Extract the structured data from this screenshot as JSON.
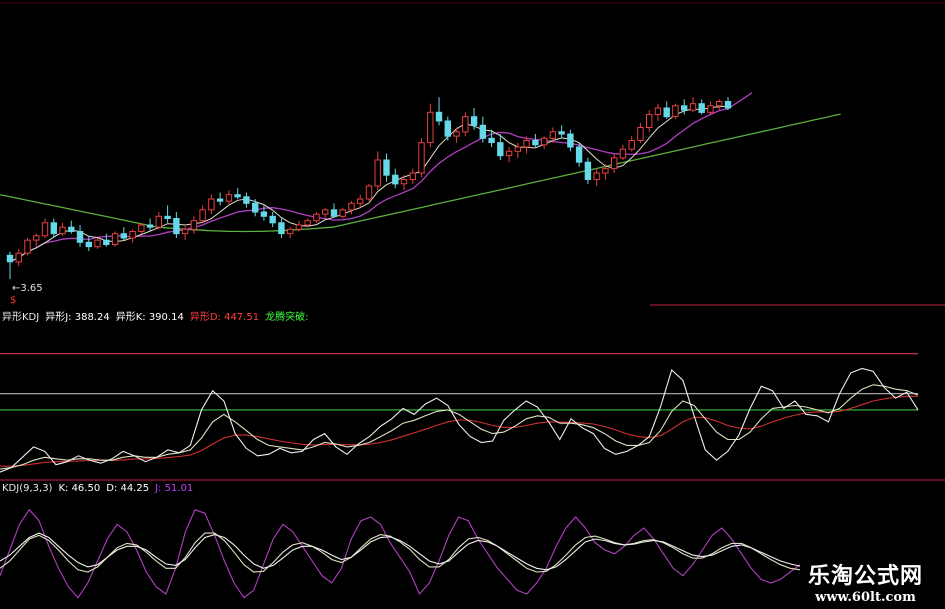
{
  "chart_data": [
    {
      "type": "candlestick",
      "panel": "price",
      "low_label": "3.65",
      "low_marker": "$",
      "colors": {
        "up": "#e8e8e8",
        "down": "#66d9e8",
        "ma_white": "#e0e0d0",
        "ma_magenta": "#b040c0",
        "ma_green": "#5ab040",
        "low_marker": "#ff3030"
      },
      "candles": [
        [
          4.2,
          4.28,
          3.65,
          4.05
        ],
        [
          4.05,
          4.35,
          3.95,
          4.25
        ],
        [
          4.25,
          4.6,
          4.2,
          4.55
        ],
        [
          4.55,
          4.7,
          4.4,
          4.65
        ],
        [
          4.65,
          5.05,
          4.6,
          4.95
        ],
        [
          4.95,
          5.05,
          4.6,
          4.7
        ],
        [
          4.7,
          4.95,
          4.65,
          4.85
        ],
        [
          4.85,
          5.0,
          4.7,
          4.75
        ],
        [
          4.75,
          4.9,
          4.4,
          4.5
        ],
        [
          4.5,
          4.65,
          4.3,
          4.4
        ],
        [
          4.4,
          4.6,
          4.35,
          4.55
        ],
        [
          4.55,
          4.7,
          4.4,
          4.45
        ],
        [
          4.45,
          4.75,
          4.4,
          4.7
        ],
        [
          4.7,
          4.85,
          4.55,
          4.6
        ],
        [
          4.6,
          4.8,
          4.5,
          4.75
        ],
        [
          4.75,
          4.95,
          4.7,
          4.9
        ],
        [
          4.9,
          5.05,
          4.75,
          4.85
        ],
        [
          4.85,
          5.2,
          4.8,
          5.1
        ],
        [
          5.1,
          5.35,
          4.95,
          5.05
        ],
        [
          5.05,
          5.2,
          4.6,
          4.7
        ],
        [
          4.7,
          4.9,
          4.55,
          4.8
        ],
        [
          4.8,
          5.1,
          4.7,
          5.0
        ],
        [
          5.0,
          5.35,
          4.95,
          5.25
        ],
        [
          5.25,
          5.6,
          5.15,
          5.5
        ],
        [
          5.5,
          5.65,
          5.35,
          5.45
        ],
        [
          5.45,
          5.7,
          5.35,
          5.6
        ],
        [
          5.6,
          5.75,
          5.5,
          5.55
        ],
        [
          5.55,
          5.65,
          5.3,
          5.4
        ],
        [
          5.4,
          5.5,
          5.1,
          5.2
        ],
        [
          5.2,
          5.35,
          5.0,
          5.1
        ],
        [
          5.1,
          5.2,
          4.85,
          4.95
        ],
        [
          4.95,
          5.05,
          4.6,
          4.7
        ],
        [
          4.7,
          4.85,
          4.6,
          4.8
        ],
        [
          4.8,
          5.0,
          4.75,
          4.9
        ],
        [
          4.9,
          5.05,
          4.85,
          5.0
        ],
        [
          5.0,
          5.2,
          4.95,
          5.15
        ],
        [
          5.15,
          5.3,
          5.05,
          5.25
        ],
        [
          5.25,
          5.4,
          5.15,
          5.1
        ],
        [
          5.1,
          5.3,
          5.05,
          5.25
        ],
        [
          5.25,
          5.45,
          5.15,
          5.4
        ],
        [
          5.4,
          5.6,
          5.3,
          5.5
        ],
        [
          5.5,
          5.85,
          5.45,
          5.8
        ],
        [
          5.8,
          6.6,
          5.7,
          6.4
        ],
        [
          6.4,
          6.55,
          5.9,
          6.05
        ],
        [
          6.05,
          6.2,
          5.75,
          5.85
        ],
        [
          5.85,
          6.05,
          5.7,
          5.95
        ],
        [
          5.95,
          6.2,
          5.85,
          6.1
        ],
        [
          6.1,
          6.9,
          6.0,
          6.8
        ],
        [
          6.8,
          7.7,
          6.7,
          7.5
        ],
        [
          7.5,
          7.85,
          7.2,
          7.3
        ],
        [
          7.3,
          7.4,
          6.85,
          6.95
        ],
        [
          6.95,
          7.15,
          6.8,
          7.05
        ],
        [
          7.05,
          7.5,
          6.95,
          7.4
        ],
        [
          7.4,
          7.6,
          7.1,
          7.2
        ],
        [
          7.2,
          7.4,
          6.8,
          6.9
        ],
        [
          6.9,
          7.1,
          6.7,
          6.8
        ],
        [
          6.8,
          7.0,
          6.4,
          6.5
        ],
        [
          6.5,
          6.7,
          6.35,
          6.6
        ],
        [
          6.6,
          6.8,
          6.45,
          6.7
        ],
        [
          6.7,
          6.95,
          6.55,
          6.85
        ],
        [
          6.85,
          7.0,
          6.7,
          6.75
        ],
        [
          6.75,
          6.95,
          6.65,
          6.9
        ],
        [
          6.9,
          7.15,
          6.8,
          7.05
        ],
        [
          7.05,
          7.2,
          6.9,
          7.0
        ],
        [
          7.0,
          7.1,
          6.6,
          6.7
        ],
        [
          6.7,
          6.8,
          6.25,
          6.35
        ],
        [
          6.35,
          6.45,
          5.85,
          5.95
        ],
        [
          5.95,
          6.2,
          5.8,
          6.1
        ],
        [
          6.1,
          6.3,
          5.95,
          6.2
        ],
        [
          6.2,
          6.55,
          6.1,
          6.45
        ],
        [
          6.45,
          6.75,
          6.4,
          6.65
        ],
        [
          6.65,
          6.95,
          6.6,
          6.85
        ],
        [
          6.85,
          7.25,
          6.8,
          7.15
        ],
        [
          7.15,
          7.55,
          7.05,
          7.45
        ],
        [
          7.45,
          7.7,
          7.3,
          7.6
        ],
        [
          7.6,
          7.75,
          7.35,
          7.4
        ],
        [
          7.4,
          7.7,
          7.35,
          7.65
        ],
        [
          7.65,
          7.8,
          7.45,
          7.55
        ],
        [
          7.55,
          7.85,
          7.5,
          7.7
        ],
        [
          7.7,
          7.8,
          7.45,
          7.5
        ],
        [
          7.5,
          7.75,
          7.45,
          7.65
        ],
        [
          7.65,
          7.8,
          7.55,
          7.75
        ],
        [
          7.75,
          7.85,
          7.55,
          7.6
        ]
      ],
      "price_range": [
        3.4,
        7.9
      ]
    },
    {
      "type": "line",
      "panel": "indicator-1",
      "header": [
        {
          "label": "异形KDJ",
          "color": "#e8e8e8"
        },
        {
          "label": "异形J: 388.24",
          "color": "#ffffff"
        },
        {
          "label": "异形K: 390.14",
          "color": "#ffffff"
        },
        {
          "label": "异形D: 447.51",
          "color": "#ff4040"
        },
        {
          "label": "龙腾突破: ",
          "color": "#40ff40"
        }
      ],
      "ylim": [
        0,
        1000
      ],
      "ref_lines": [
        {
          "value": 840,
          "color": "#e0305a"
        },
        {
          "value": 570,
          "color": "#a0a0a0"
        },
        {
          "value": 460,
          "color": "#40c040"
        }
      ],
      "series": [
        {
          "color": "#f0f0f0",
          "values": [
            40,
            70,
            140,
            210,
            180,
            90,
            110,
            150,
            120,
            100,
            130,
            180,
            150,
            110,
            140,
            190,
            170,
            220,
            460,
            590,
            520,
            300,
            200,
            150,
            160,
            200,
            170,
            180,
            260,
            300,
            210,
            160,
            230,
            280,
            350,
            400,
            470,
            430,
            500,
            540,
            490,
            360,
            280,
            240,
            250,
            390,
            460,
            520,
            480,
            380,
            260,
            400,
            340,
            300,
            200,
            160,
            180,
            220,
            280,
            480,
            730,
            660,
            420,
            190,
            120,
            180,
            290,
            470,
            620,
            590,
            470,
            520,
            430,
            420,
            380,
            570,
            710,
            740,
            720,
            610,
            540,
            580,
            460
          ]
        },
        {
          "color": "#e0e0c0",
          "values": [
            60,
            70,
            90,
            120,
            140,
            130,
            120,
            130,
            130,
            120,
            120,
            140,
            150,
            140,
            140,
            160,
            170,
            190,
            270,
            380,
            430,
            380,
            320,
            260,
            220,
            210,
            200,
            190,
            210,
            240,
            230,
            210,
            220,
            240,
            280,
            320,
            370,
            390,
            420,
            450,
            460,
            430,
            380,
            330,
            300,
            310,
            350,
            400,
            420,
            410,
            370,
            370,
            360,
            340,
            300,
            250,
            220,
            220,
            240,
            320,
            450,
            520,
            490,
            400,
            310,
            260,
            260,
            310,
            400,
            470,
            480,
            490,
            480,
            460,
            440,
            470,
            540,
            600,
            630,
            620,
            600,
            590,
            560
          ]
        },
        {
          "color": "#d03030",
          "values": [
            80,
            80,
            85,
            95,
            105,
            110,
            112,
            115,
            118,
            118,
            118,
            122,
            128,
            130,
            132,
            138,
            145,
            155,
            185,
            230,
            270,
            290,
            290,
            280,
            265,
            250,
            238,
            228,
            222,
            226,
            228,
            225,
            224,
            228,
            240,
            258,
            282,
            305,
            330,
            355,
            380,
            392,
            390,
            375,
            355,
            342,
            342,
            355,
            370,
            380,
            378,
            376,
            372,
            365,
            348,
            325,
            298,
            280,
            272,
            286,
            330,
            380,
            410,
            408,
            385,
            355,
            338,
            332,
            350,
            380,
            405,
            425,
            440,
            447,
            445,
            450,
            470,
            495,
            520,
            535,
            545,
            552,
            552
          ]
        }
      ]
    },
    {
      "type": "line",
      "panel": "indicator-2",
      "header": [
        {
          "label": "KDJ(9,3,3)",
          "color": "#e8e8e8"
        },
        {
          "label": "K: 46.50",
          "color": "#ffffff"
        },
        {
          "label": "D: 44.25",
          "color": "#ffffff"
        },
        {
          "label": "J: 51.01",
          "color": "#c040ff"
        }
      ],
      "ylim": [
        -20,
        130
      ],
      "series": [
        {
          "color": "#b040c0",
          "values": [
            20,
            55,
            90,
            110,
            95,
            60,
            30,
            5,
            -10,
            10,
            40,
            70,
            90,
            80,
            55,
            25,
            5,
            -5,
            30,
            80,
            110,
            105,
            75,
            40,
            10,
            -10,
            0,
            35,
            70,
            90,
            80,
            60,
            40,
            20,
            10,
            30,
            70,
            95,
            100,
            90,
            65,
            45,
            25,
            -5,
            10,
            40,
            75,
            100,
            95,
            70,
            50,
            30,
            15,
            0,
            -5,
            10,
            30,
            60,
            85,
            100,
            85,
            65,
            55,
            50,
            60,
            75,
            85,
            70,
            50,
            30,
            20,
            35,
            55,
            75,
            85,
            70,
            50,
            30,
            15,
            10,
            15,
            25,
            35
          ]
        },
        {
          "color": "#e0e0c0",
          "values": [
            30,
            40,
            55,
            70,
            75,
            68,
            55,
            40,
            28,
            25,
            32,
            45,
            58,
            64,
            62,
            52,
            40,
            30,
            30,
            45,
            65,
            78,
            78,
            68,
            52,
            35,
            25,
            26,
            38,
            52,
            62,
            65,
            60,
            52,
            42,
            38,
            45,
            58,
            70,
            76,
            74,
            66,
            56,
            42,
            32,
            32,
            42,
            58,
            70,
            72,
            68,
            60,
            50,
            40,
            30,
            25,
            26,
            35,
            48,
            62,
            72,
            74,
            70,
            65,
            62,
            64,
            68,
            69,
            65,
            58,
            50,
            44,
            44,
            50,
            58,
            64,
            64,
            58,
            50,
            42,
            35,
            30,
            28
          ]
        },
        {
          "color": "#f0f0f0",
          "values": [
            40,
            48,
            60,
            72,
            78,
            72,
            60,
            48,
            38,
            32,
            35,
            45,
            55,
            60,
            60,
            55,
            45,
            36,
            34,
            42,
            58,
            72,
            76,
            72,
            62,
            48,
            36,
            30,
            34,
            44,
            55,
            60,
            60,
            55,
            48,
            42,
            45,
            55,
            66,
            72,
            73,
            68,
            60,
            50,
            40,
            36,
            40,
            52,
            63,
            68,
            66,
            60,
            52,
            44,
            36,
            30,
            28,
            32,
            42,
            54,
            66,
            70,
            68,
            64,
            62,
            63,
            66,
            68,
            66,
            60,
            54,
            48,
            46,
            48,
            54,
            60,
            62,
            58,
            52,
            46,
            40,
            36,
            33
          ]
        }
      ]
    }
  ],
  "watermark": {
    "title": "乐淘公式网",
    "url": "www.60lt.com"
  }
}
